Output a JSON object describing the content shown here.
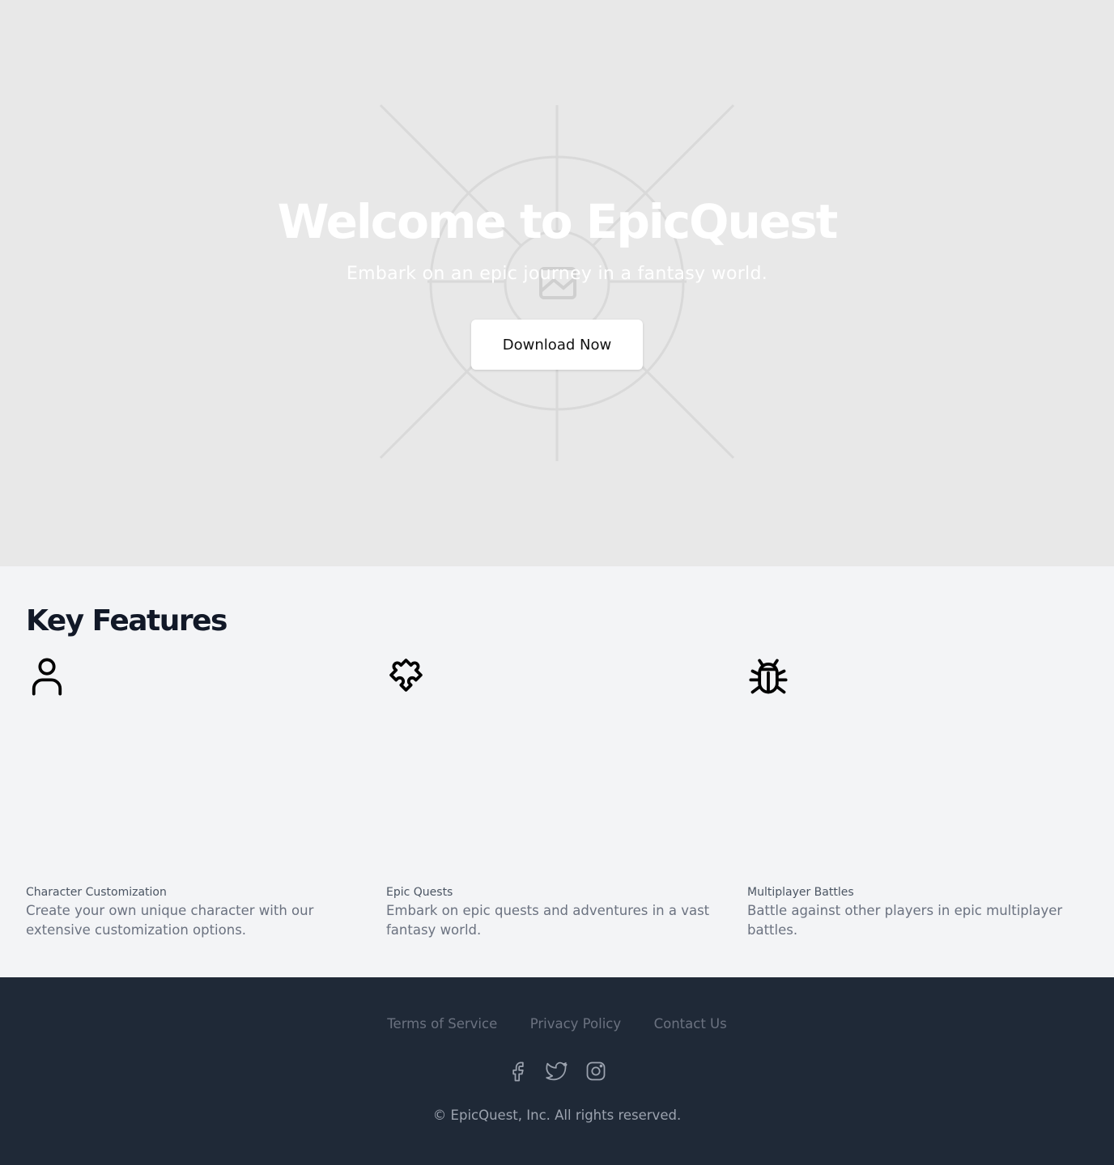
{
  "hero": {
    "title": "Welcome to EpicQuest",
    "subtitle": "Embark on an epic journey in a fantasy world.",
    "button_label": "Download Now",
    "background_image": "image-placeholder-icon"
  },
  "features": {
    "heading": "Key Features",
    "items": [
      {
        "icon": "user-icon",
        "title": "Character Customization",
        "description": "Create your own unique character with our extensive customization options."
      },
      {
        "icon": "puzzle-icon",
        "title": "Epic Quests",
        "description": "Embark on epic quests and adventures in a vast fantasy world."
      },
      {
        "icon": "bug-icon",
        "title": "Multiplayer Battles",
        "description": "Battle against other players in epic multiplayer battles."
      }
    ]
  },
  "footer": {
    "links": [
      "Terms of Service",
      "Privacy Policy",
      "Contact Us"
    ],
    "social": [
      "facebook-icon",
      "twitter-icon",
      "instagram-icon"
    ],
    "copyright": "© EpicQuest, Inc. All rights reserved."
  },
  "colors": {
    "hero_bg": "#e8e8e8",
    "features_bg": "#f3f4f6",
    "footer_bg": "#1f2937",
    "heading": "#111827",
    "muted_text": "#6b7280"
  }
}
